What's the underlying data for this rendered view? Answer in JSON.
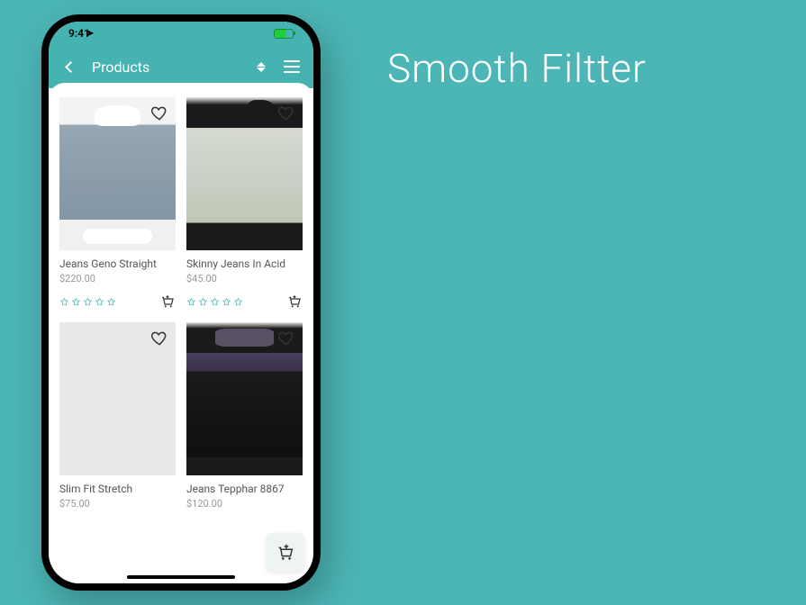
{
  "page_heading": "Smooth Filtter",
  "statusbar": {
    "time": "9:41"
  },
  "navbar": {
    "title": "Products"
  },
  "products": [
    {
      "name": "Jeans Geno Straight",
      "price": "$220.00"
    },
    {
      "name": "Skinny Jeans In Acid",
      "price": "$45.00"
    },
    {
      "name": "Slim Fit Stretch",
      "price": "$75.00"
    },
    {
      "name": "Jeans Tepphar 8867",
      "price": "$120.00"
    }
  ],
  "colors": {
    "accent": "#44b3b1",
    "star": "#44b3b1"
  }
}
